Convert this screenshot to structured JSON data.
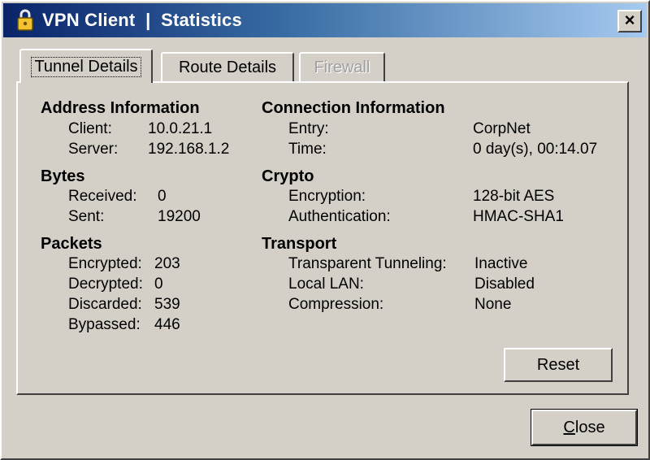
{
  "window": {
    "app_name": "VPN Client",
    "separator": "|",
    "section": "Statistics",
    "close_glyph": "×"
  },
  "tabs": [
    {
      "label": "Tunnel Details",
      "state": "active"
    },
    {
      "label": "Route Details",
      "state": "normal"
    },
    {
      "label": "Firewall",
      "state": "disabled"
    }
  ],
  "address": {
    "heading": "Address Information",
    "client_label": "Client:",
    "client_value": "10.0.21.1",
    "server_label": "Server:",
    "server_value": "192.168.1.2"
  },
  "bytes": {
    "heading": "Bytes",
    "received_label": "Received:",
    "received_value": "0",
    "sent_label": "Sent:",
    "sent_value": "19200"
  },
  "packets": {
    "heading": "Packets",
    "encrypted_label": "Encrypted:",
    "encrypted_value": "203",
    "decrypted_label": "Decrypted:",
    "decrypted_value": "0",
    "discarded_label": "Discarded:",
    "discarded_value": "539",
    "bypassed_label": "Bypassed:",
    "bypassed_value": "446"
  },
  "connection": {
    "heading": "Connection Information",
    "entry_label": "Entry:",
    "entry_value": "CorpNet",
    "time_label": "Time:",
    "time_value": "0 day(s), 00:14.07"
  },
  "crypto": {
    "heading": "Crypto",
    "encryption_label": "Encryption:",
    "encryption_value": "128-bit AES",
    "authentication_label": "Authentication:",
    "authentication_value": "HMAC-SHA1"
  },
  "transport": {
    "heading": "Transport",
    "tunneling_label": "Transparent Tunneling:",
    "tunneling_value": "Inactive",
    "local_lan_label": "Local LAN:",
    "local_lan_value": "Disabled",
    "compression_label": "Compression:",
    "compression_value": "None"
  },
  "buttons": {
    "reset": "Reset",
    "close_accel": "C",
    "close_rest": "lose"
  },
  "colors": {
    "title_start": "#0a246a",
    "title_end": "#a6caf0",
    "face": "#d4d0c8"
  },
  "icons": {
    "title": "padlock-icon"
  }
}
